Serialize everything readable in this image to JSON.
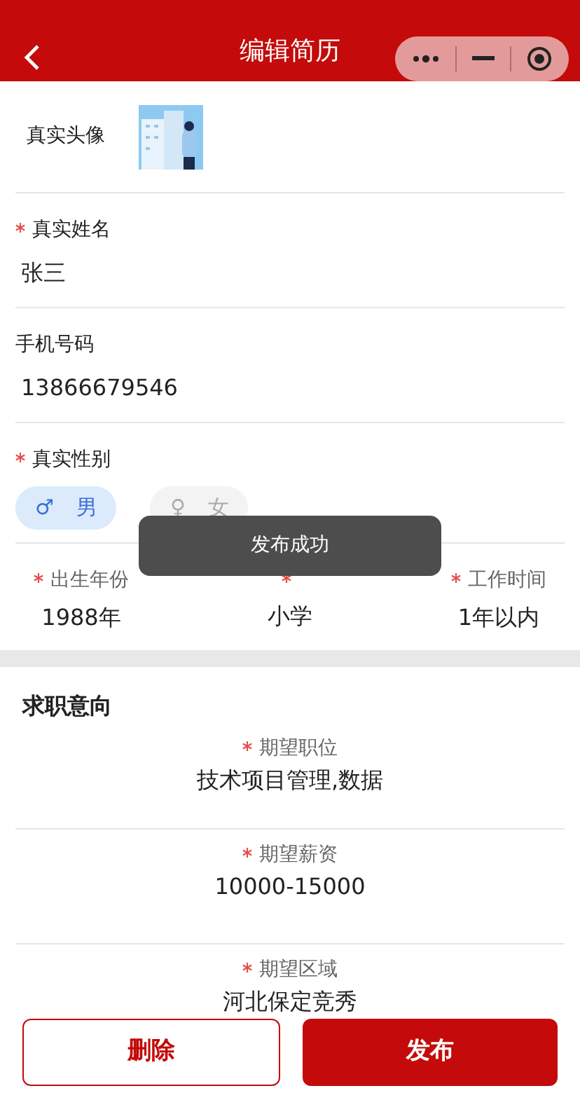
{
  "header": {
    "title": "编辑简历"
  },
  "avatar": {
    "label": "真实头像",
    "kind": "picture"
  },
  "fields": [
    {
      "label": "真实姓名",
      "required": true,
      "value": "张三"
    },
    {
      "label": "手机号码",
      "required": false,
      "value": "13866679546"
    }
  ],
  "gender": {
    "label": "真实性别",
    "required": true,
    "options": [
      {
        "symbol": "♂",
        "label": "男",
        "selected": true
      },
      {
        "symbol": "♀",
        "label": "女",
        "selected": false
      }
    ]
  },
  "basics": [
    {
      "label": "出生年份",
      "required": true,
      "value": "1988年"
    },
    {
      "required": true,
      "value": "小学"
    },
    {
      "label": "工作时间",
      "required": true,
      "value": "1年以内"
    }
  ],
  "intent": {
    "title": "求职意向",
    "fields": [
      {
        "label": "期望职位",
        "required": true,
        "value": "技术项目管理,数据"
      },
      {
        "label": "期望薪资",
        "required": true,
        "value": "10000-15000"
      },
      {
        "label": "期望区域",
        "required": true,
        "value": "河北保定竞秀"
      }
    ]
  },
  "buttons": [
    {
      "label": "删除",
      "kind": "outline"
    },
    {
      "label": "发布",
      "kind": "primary"
    }
  ],
  "toast": "发布成功"
}
